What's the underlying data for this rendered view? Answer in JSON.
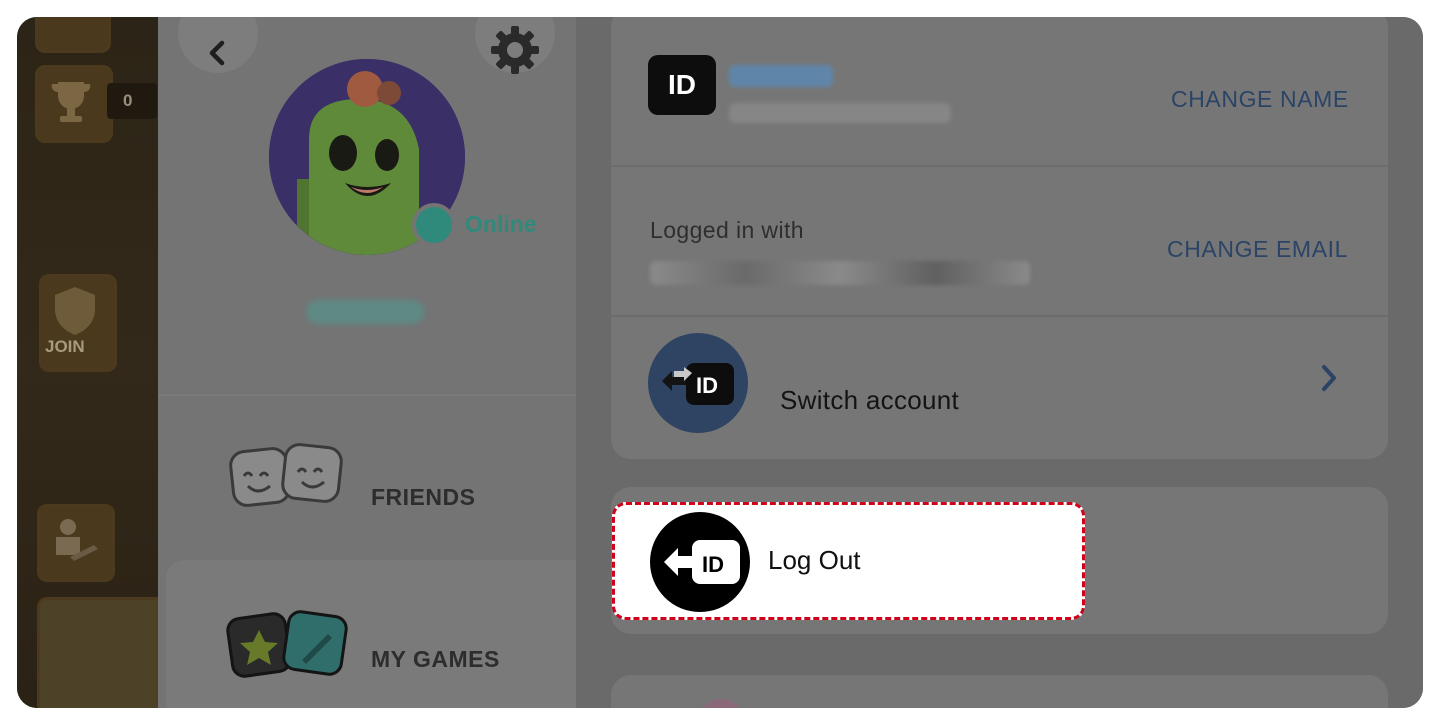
{
  "game_strip": {
    "trophy_count": "0",
    "join_label": "JOIN"
  },
  "profile": {
    "status": "Online",
    "status_color": "#2f8a7b"
  },
  "nav": {
    "friends_label": "FRIENDS",
    "games_label": "MY GAMES"
  },
  "account": {
    "id_badge_text": "ID",
    "change_name_label": "CHANGE NAME",
    "logged_in_with_label": "Logged in with",
    "change_email_label": "CHANGE EMAIL",
    "switch_account_label": "Switch account",
    "logout_label": "Log Out"
  },
  "colors": {
    "highlight_border": "#d0021b",
    "link": "#2b4466"
  },
  "icons": [
    "back-icon",
    "settings-gear-icon",
    "trophy-icon",
    "shield-icon",
    "friends-icon",
    "games-icon",
    "id-icon",
    "switch-account-icon",
    "chevron-right-icon",
    "logout-icon"
  ]
}
